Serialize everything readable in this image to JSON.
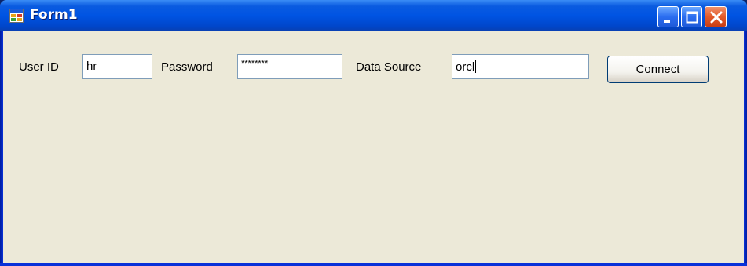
{
  "window": {
    "title": "Form1",
    "icon": "app-form-icon",
    "controls": {
      "minimize": "minimize-icon",
      "maximize": "maximize-icon",
      "close": "close-icon"
    }
  },
  "form": {
    "user_id_label": "User ID",
    "user_id_value": "hr",
    "password_label": "Password",
    "password_value": "********",
    "data_source_label": "Data Source",
    "data_source_value": "orcl",
    "connect_label": "Connect"
  },
  "colors": {
    "titlebar": "#0054e3",
    "client_background": "#ece9d8",
    "textbox_border": "#7f9db9",
    "close_button": "#e25a2a"
  }
}
